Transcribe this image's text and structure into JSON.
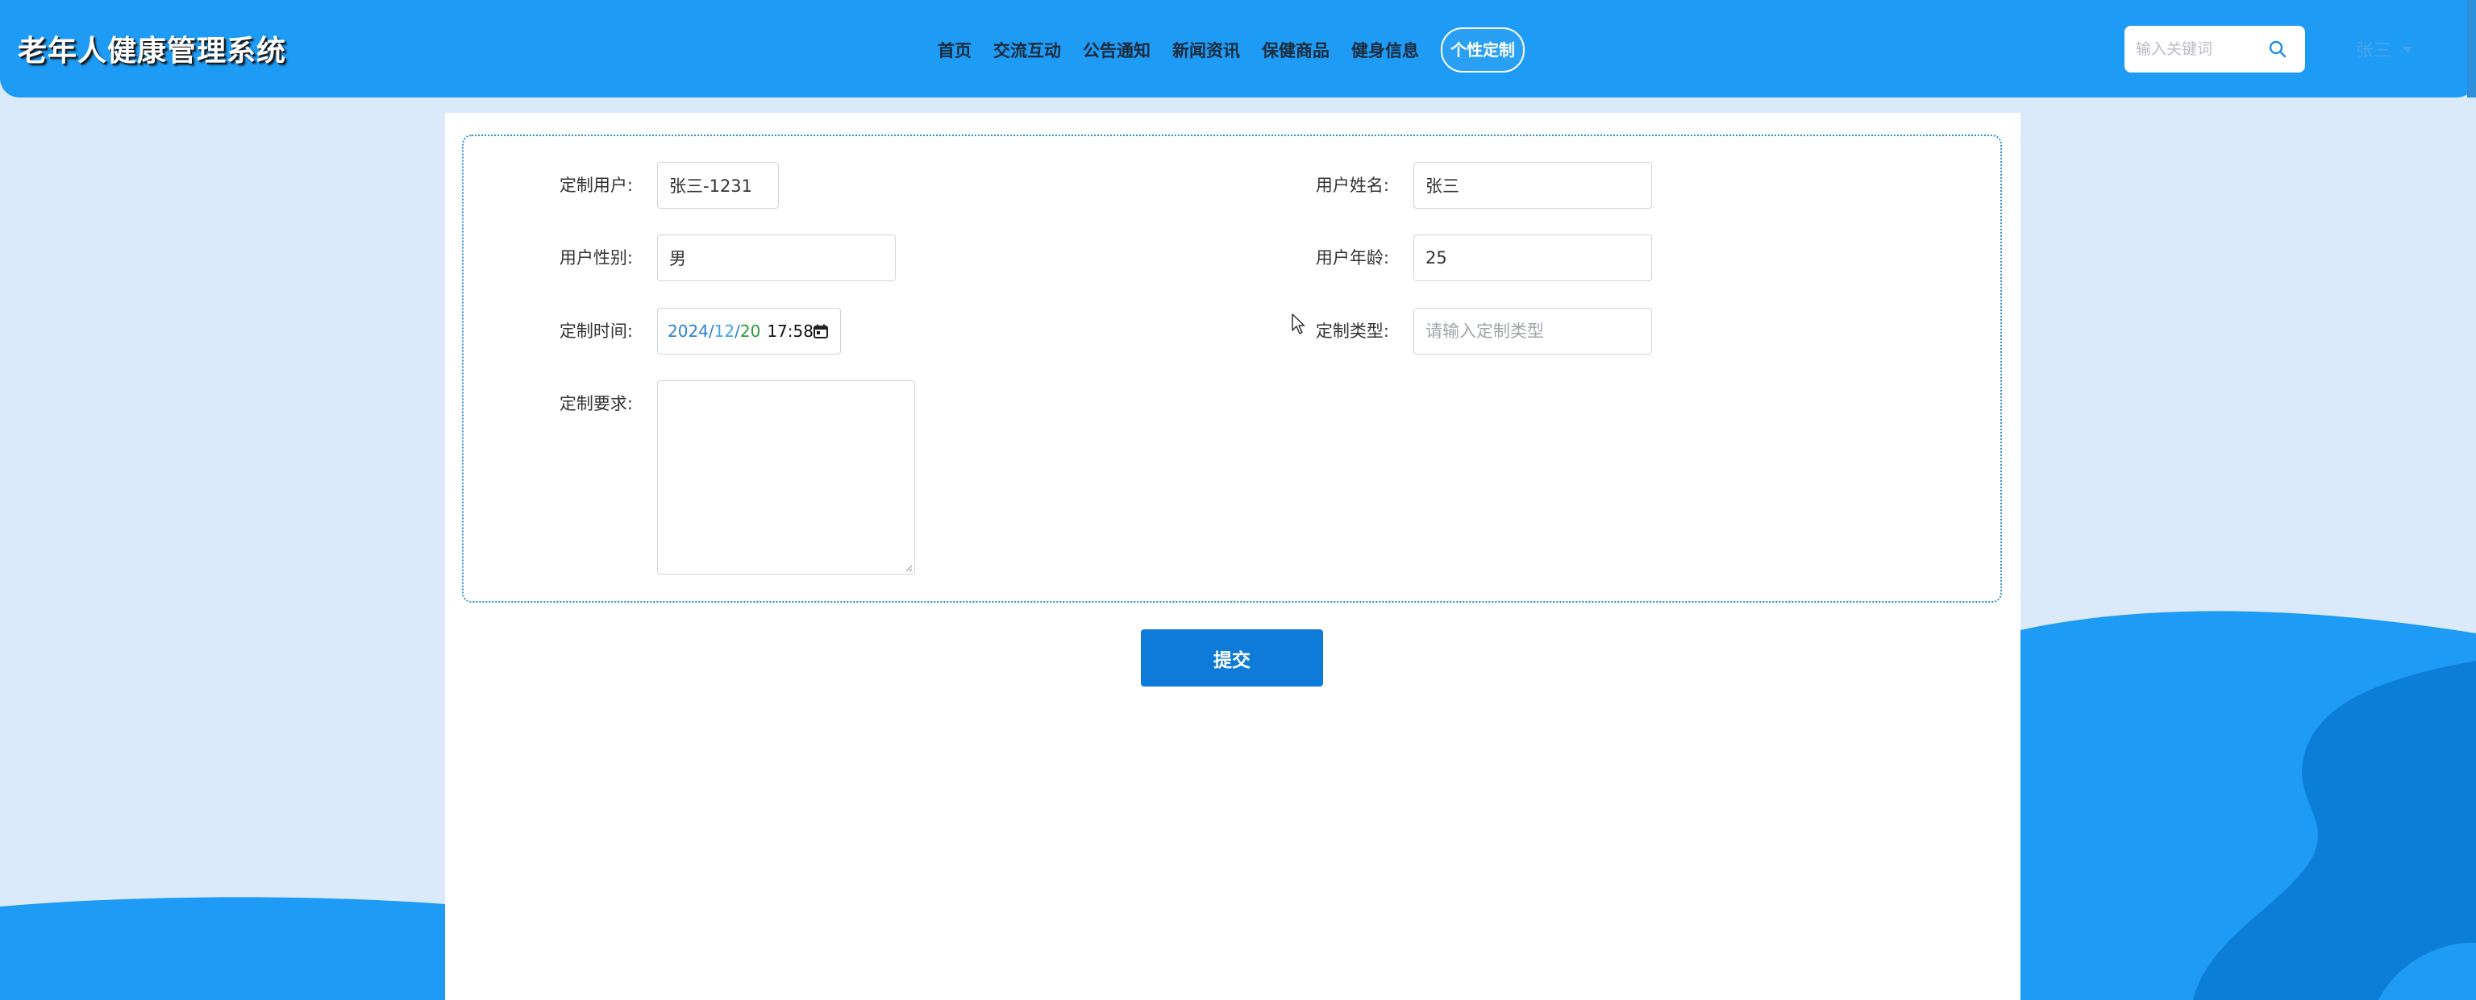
{
  "header": {
    "site_title": "老年人健康管理系统",
    "nav": [
      {
        "label": "首页",
        "active": false
      },
      {
        "label": "交流互动",
        "active": false
      },
      {
        "label": "公告通知",
        "active": false
      },
      {
        "label": "新闻资讯",
        "active": false
      },
      {
        "label": "保健商品",
        "active": false
      },
      {
        "label": "健身信息",
        "active": false
      },
      {
        "label": "个性定制",
        "active": true
      }
    ],
    "search": {
      "placeholder": "输入关键词",
      "icon": "search-icon"
    },
    "user": {
      "name": "张三",
      "icon": "chevron-down-icon"
    }
  },
  "form": {
    "custom_user": {
      "label": "定制用户:",
      "value": "张三-1231"
    },
    "user_name": {
      "label": "用户姓名:",
      "value": "张三"
    },
    "user_gender": {
      "label": "用户性别:",
      "value": "男"
    },
    "user_age": {
      "label": "用户年龄:",
      "value": "25"
    },
    "custom_time": {
      "label": "定制时间:",
      "year": "2024",
      "month": "12",
      "day": "20",
      "sep": "/",
      "time": "17:58",
      "icon": "calendar-icon"
    },
    "custom_type": {
      "label": "定制类型:",
      "placeholder": "请输入定制类型"
    },
    "custom_requirement": {
      "label": "定制要求:",
      "value": ""
    },
    "submit_label": "提交"
  },
  "colors": {
    "header_bg": "#1d9bf5",
    "page_bg": "#dbeafa",
    "wave": "#1d9bf5",
    "wave_dark": "#0c7ed8",
    "submit_bg": "#0f7bd9",
    "form_border": "#2a8fd6"
  }
}
